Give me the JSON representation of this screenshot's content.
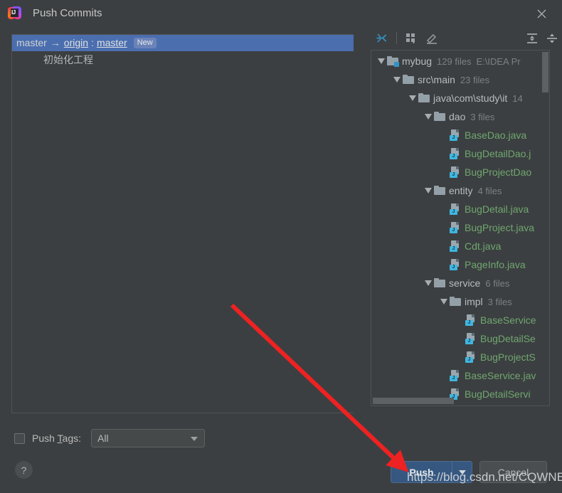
{
  "window": {
    "title": "Push Commits",
    "app_icon": "intellij-idea-logo",
    "close_icon": "close-icon"
  },
  "commit_list": {
    "branch_row": {
      "local_branch": "master",
      "arrow": "→",
      "remote_name": "origin",
      "separator": ":",
      "remote_branch": "master",
      "badge": "New"
    },
    "commits": [
      {
        "message": "初始化工程"
      }
    ]
  },
  "tree_toolbar": {
    "buttons": [
      {
        "name": "collapse-to-left-icon",
        "tooltip": "Collapse"
      },
      {
        "name": "group-by-icon",
        "tooltip": "Group By"
      },
      {
        "name": "edit-icon",
        "tooltip": "Edit"
      },
      {
        "name": "expand-all-icon",
        "tooltip": "Expand All"
      },
      {
        "name": "collapse-all-icon",
        "tooltip": "Collapse All"
      }
    ]
  },
  "file_tree": {
    "nodes": [
      {
        "indent": 0,
        "toggle": "expanded",
        "icon": "folder-module",
        "name": "mybug",
        "count": "129 files",
        "path": "E:\\IDEA Pr"
      },
      {
        "indent": 1,
        "toggle": "expanded",
        "icon": "folder",
        "name": "src\\main",
        "count": "23 files",
        "path": ""
      },
      {
        "indent": 2,
        "toggle": "expanded",
        "icon": "folder",
        "name": "java\\com\\study\\it",
        "count": "14",
        "path": ""
      },
      {
        "indent": 3,
        "toggle": "expanded",
        "icon": "folder",
        "name": "dao",
        "count": "3 files",
        "path": ""
      },
      {
        "indent": 4,
        "toggle": "none",
        "icon": "java-file",
        "name": "BaseDao.java",
        "count": "",
        "path": ""
      },
      {
        "indent": 4,
        "toggle": "none",
        "icon": "java-file",
        "name": "BugDetailDao.j",
        "count": "",
        "path": ""
      },
      {
        "indent": 4,
        "toggle": "none",
        "icon": "java-file",
        "name": "BugProjectDao",
        "count": "",
        "path": ""
      },
      {
        "indent": 3,
        "toggle": "expanded",
        "icon": "folder",
        "name": "entity",
        "count": "4 files",
        "path": ""
      },
      {
        "indent": 4,
        "toggle": "none",
        "icon": "java-file",
        "name": "BugDetail.java",
        "count": "",
        "path": ""
      },
      {
        "indent": 4,
        "toggle": "none",
        "icon": "java-file",
        "name": "BugProject.java",
        "count": "",
        "path": ""
      },
      {
        "indent": 4,
        "toggle": "none",
        "icon": "java-file",
        "name": "Cdt.java",
        "count": "",
        "path": ""
      },
      {
        "indent": 4,
        "toggle": "none",
        "icon": "java-file",
        "name": "PageInfo.java",
        "count": "",
        "path": ""
      },
      {
        "indent": 3,
        "toggle": "expanded",
        "icon": "folder",
        "name": "service",
        "count": "6 files",
        "path": ""
      },
      {
        "indent": 4,
        "toggle": "expanded",
        "icon": "folder",
        "name": "impl",
        "count": "3 files",
        "path": ""
      },
      {
        "indent": 5,
        "toggle": "none",
        "icon": "java-file",
        "name": "BaseService",
        "count": "",
        "path": ""
      },
      {
        "indent": 5,
        "toggle": "none",
        "icon": "java-file",
        "name": "BugDetailSe",
        "count": "",
        "path": ""
      },
      {
        "indent": 5,
        "toggle": "none",
        "icon": "java-file",
        "name": "BugProjectS",
        "count": "",
        "path": ""
      },
      {
        "indent": 4,
        "toggle": "none",
        "icon": "java-file",
        "name": "BaseService.jav",
        "count": "",
        "path": ""
      },
      {
        "indent": 4,
        "toggle": "none",
        "icon": "java-file",
        "name": "BugDetailServi",
        "count": "",
        "path": ""
      }
    ]
  },
  "footer": {
    "push_tags_label_pre": "Push ",
    "push_tags_label_mnemonic": "T",
    "push_tags_label_post": "ags:",
    "tags_value": "All",
    "tags_options": [
      "All"
    ],
    "checkbox_checked": false,
    "help_label": "?",
    "push_button": "Push",
    "cancel_button": "Cancel"
  },
  "annotation": {
    "arrow_color": "#ee2222",
    "watermark": "https://blog.csdn.net/CQWNB"
  },
  "colors": {
    "window_bg": "#3c3f41",
    "selection_blue": "#4b6eaf",
    "java_green": "#6fa76f",
    "accent_blue": "#3592c4",
    "push_button": "#365880"
  }
}
